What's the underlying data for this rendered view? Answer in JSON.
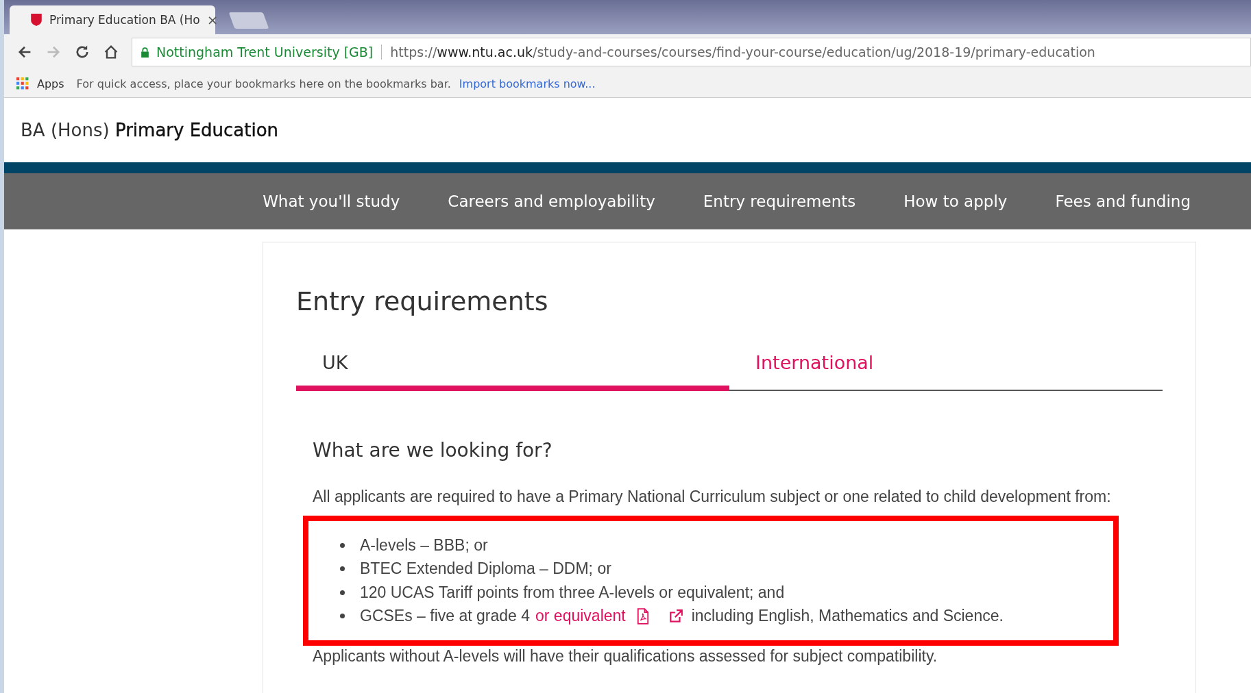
{
  "browser": {
    "tab": {
      "title": "Primary Education BA (Ho",
      "close": "×"
    },
    "address": {
      "site": "Nottingham Trent University [GB]",
      "url_scheme": "https://",
      "url_host": "www.ntu.ac.uk",
      "url_path": "/study-and-courses/courses/find-your-course/education/ug/2018-19/primary-education"
    },
    "bookmarks": {
      "apps": "Apps",
      "hint": "For quick access, place your bookmarks here on the bookmarks bar.",
      "link": "Import bookmarks now..."
    }
  },
  "header": {
    "prefix": "BA (Hons)",
    "title": "Primary Education"
  },
  "nav": [
    "What you'll study",
    "Careers and employability",
    "Entry requirements",
    "How to apply",
    "Fees and funding"
  ],
  "section": {
    "title": "Entry requirements",
    "tabs": [
      {
        "label": "UK",
        "selected": true
      },
      {
        "label": "International",
        "selected": false
      }
    ],
    "subtitle": "What are we looking for?",
    "intro": "All applicants are required to have a Primary National Curriculum subject or one related to child development from:",
    "requirements": [
      {
        "text": "A-levels – BBB; or"
      },
      {
        "text": "BTEC Extended Diploma – DDM; or"
      },
      {
        "text": "120 UCAS Tariff points from three A-levels or equivalent; and"
      },
      {
        "text": "GCSEs – five at grade 4",
        "link": "or equivalent",
        "after": "including English, Mathematics and Science."
      }
    ],
    "note": "Applicants without A-levels will have their qualifications assessed for subject compatibility."
  }
}
